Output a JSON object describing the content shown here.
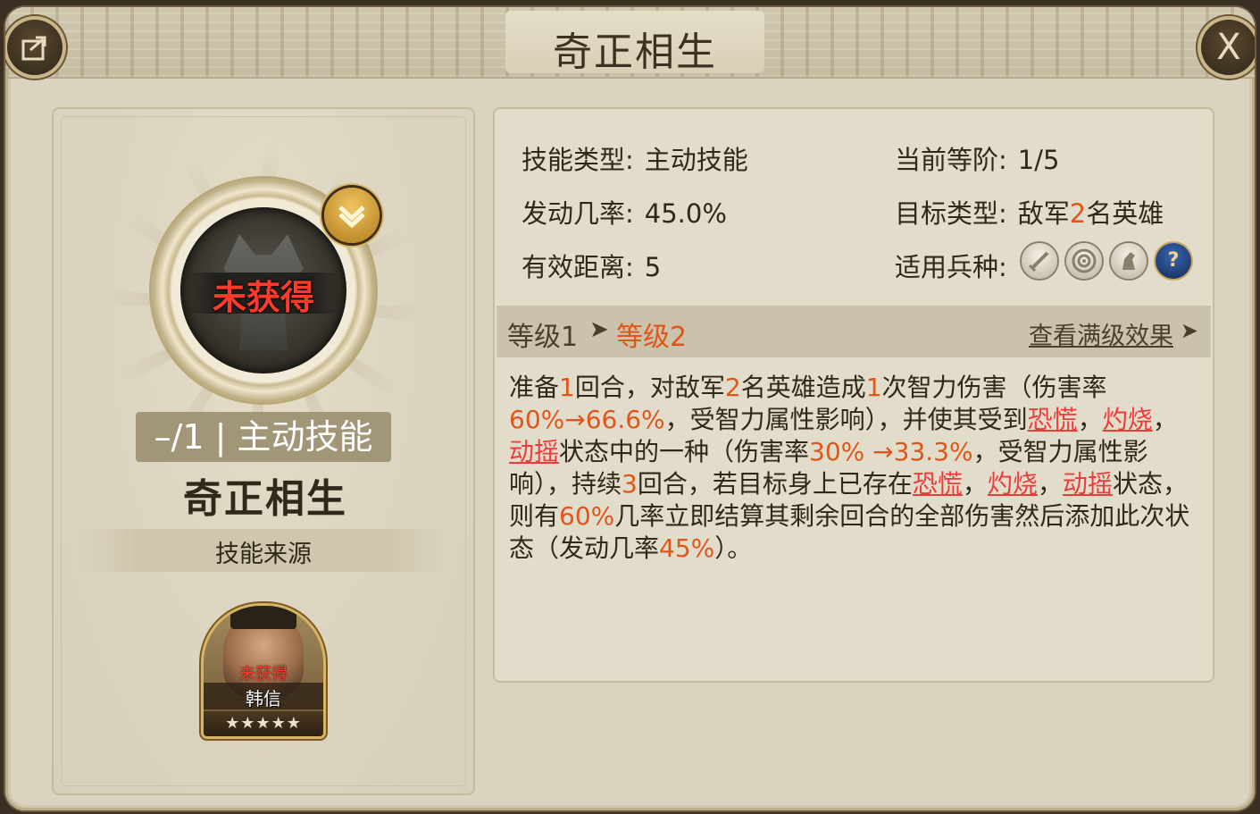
{
  "window": {
    "title": "奇正相生",
    "share_icon": "share-icon",
    "close_label": "X"
  },
  "left": {
    "status": "未获得",
    "tag": "–/1 | 主动技能",
    "name": "奇正相生",
    "source_label": "技能来源",
    "hero": {
      "status": "未获得",
      "name": "韩信",
      "stars": "★★★★★"
    }
  },
  "info": {
    "skill_type_label": "技能类型:",
    "skill_type_value": "主动技能",
    "current_rank_label": "当前等阶:",
    "current_rank_value": "1/5",
    "trigger_rate_label": "发动几率:",
    "trigger_rate_value": "45.0%",
    "target_type_label": "目标类型:",
    "target_type_prefix": "敌军",
    "target_type_count": "2",
    "target_type_suffix": "名英雄",
    "range_label": "有效距离:",
    "range_value": "5",
    "troop_label": "适用兵种:",
    "troop_icons": [
      "sword-icon",
      "target-icon",
      "horse-icon",
      "question-icon"
    ]
  },
  "levels": {
    "level1": "等级1",
    "level2": "等级2",
    "max_effect": "查看满级效果"
  },
  "description": {
    "t1": "准备",
    "n1": "1",
    "t2": "回合，对敌军",
    "n2": "2",
    "t3": "名英雄造成",
    "n3": "1",
    "t4": "次智力伤害（伤害率",
    "n4": "60%→66.6%",
    "t5": "，受智力属性影响），并使其受到",
    "s1": "恐慌",
    "t6": "，",
    "s2": "灼烧",
    "t7": "，",
    "s3": "动摇",
    "t8": "状态中的一种（伤害率",
    "n5": "30% →33.3%",
    "t9": "，受智力属性影响），持续",
    "n6": "3",
    "t10": "回合，若目标身上已存在",
    "s4": "恐慌",
    "t11": "，",
    "s5": "灼烧",
    "t12": "，",
    "s6": "动摇",
    "t13": "状态，则有",
    "n7": "60%",
    "t14": "几率立即结算其剩余回合的全部伤害然后添加此次状态（发动几率",
    "n8": "45%",
    "t15": "）。"
  },
  "colors": {
    "accent_orange": "#e0561a",
    "status_red": "#ef3b3b"
  }
}
